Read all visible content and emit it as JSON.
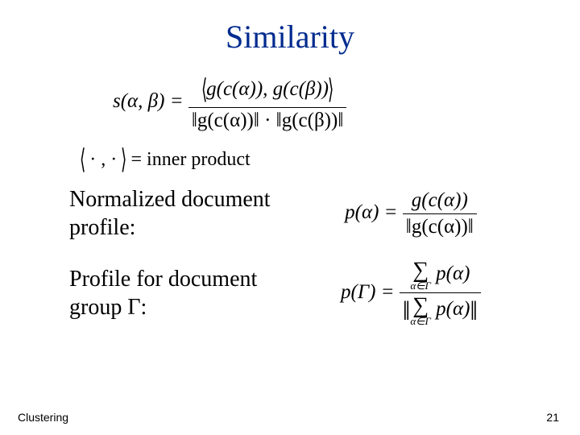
{
  "title": "Similarity",
  "eq_main": {
    "lhs": "s(α, β) =",
    "num_l": "⟨",
    "num_c": "g(c(α)), g(c(β))",
    "num_r": "⟩",
    "den": "‖g(c(α))‖ · ‖g(c(β))‖"
  },
  "ip_def": {
    "l": "⟨",
    "mid": " · , · ",
    "r": "⟩",
    "txt": " = inner product"
  },
  "row_norm": {
    "label": "Normalized document profile:",
    "lhs": "p(α) =",
    "num": "g(c(α))",
    "den": "‖g(c(α))‖"
  },
  "row_group": {
    "label": "Profile for document group Γ:",
    "lhs": "p(Γ) =",
    "num_sub": "α∈Γ",
    "num_body": " p(α)",
    "den_pre": "‖",
    "den_sub": "α∈Γ",
    "den_body": " p(α)",
    "den_post": "‖"
  },
  "footer": {
    "left": "Clustering",
    "right": "21"
  }
}
